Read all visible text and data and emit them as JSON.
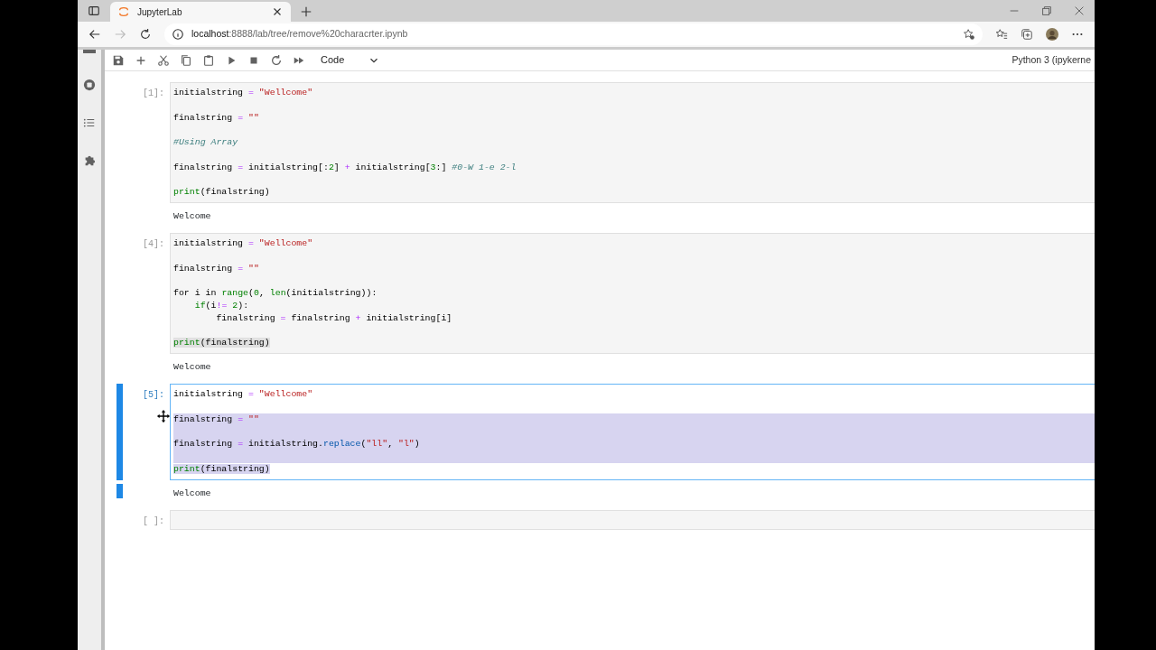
{
  "browser": {
    "tab": {
      "title": "JupyterLab",
      "selected": true
    },
    "url_host": "localhost",
    "url_path": ":8888/lab/tree/remove%20characrter.ipynb"
  },
  "toolbar": {
    "cell_type": "Code",
    "kernel": "Python 3 (ipykerne"
  },
  "cells": [
    {
      "prompt": "[1]:",
      "active": false,
      "lines": [
        {
          "text": "initialstring = \"Wellcome\"",
          "blank_after": true,
          "selected": false
        },
        {
          "text": "finalstring = \"\"",
          "blank_after": true,
          "selected": false
        },
        {
          "text": "#Using Array",
          "blank_after": true,
          "selected": false
        },
        {
          "text": "finalstring = initialstring[:2] + initialstring[3:] #0-W 1-e 2-l",
          "blank_after": true,
          "selected": false
        },
        {
          "text": "print(finalstring)",
          "blank_after": false,
          "selected": false
        }
      ],
      "output": "Welcome"
    },
    {
      "prompt": "[4]:",
      "active": false,
      "lines": [
        {
          "text": "initialstring = \"Wellcome\"",
          "blank_after": true,
          "selected": false
        },
        {
          "text": "finalstring = \"\"",
          "blank_after": true,
          "selected": false
        },
        {
          "text": "for i in range(0, len(initialstring)):",
          "blank_after": false,
          "selected": false
        },
        {
          "text": "    if(i!= 2):",
          "blank_after": false,
          "selected": false
        },
        {
          "text": "        finalstring = finalstring + initialstring[i]",
          "blank_after": true,
          "selected": false
        },
        {
          "text": "print(finalstring)",
          "blank_after": false,
          "selected": false,
          "highlighted": true
        }
      ],
      "output": "Welcome"
    },
    {
      "prompt": "[5]:",
      "active": true,
      "lines": [
        {
          "text": "initialstring = \"Wellcome\"",
          "blank_after": true,
          "selected": false
        },
        {
          "text": "finalstring = \"\"",
          "blank_after": true,
          "selected": true
        },
        {
          "text": "finalstring = initialstring.replace(\"ll\", \"l\")",
          "blank_after": true,
          "selected": true
        },
        {
          "text": "print(finalstring)",
          "blank_after": false,
          "selected": false,
          "highlighted": true
        }
      ],
      "output": "Welcome"
    },
    {
      "prompt": "[ ]:",
      "active": false
    }
  ]
}
